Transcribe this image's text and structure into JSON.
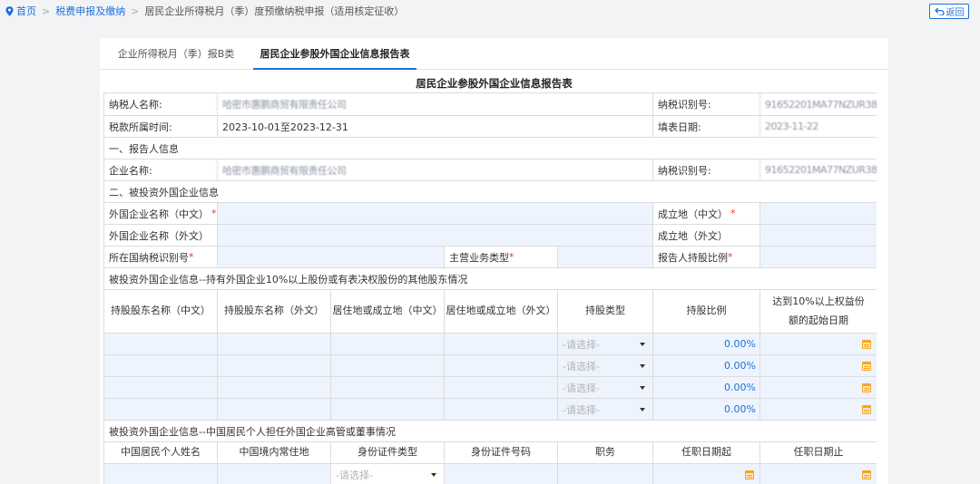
{
  "breadcrumb": {
    "home": "首页",
    "level2": "税费申报及缴纳",
    "current": "居民企业所得税月（季）度预缴纳税申报（适用核定征收）"
  },
  "back_button": "返回",
  "tabs": [
    "企业所得税月（季）报B类",
    "居民企业参股外国企业信息报告表"
  ],
  "form_title": "居民企业参股外国企业信息报告表",
  "basic": {
    "taxpayer_name_label": "纳税人名称:",
    "taxpayer_name_value": "哈密市惠鹏商贸有限责任公司",
    "tax_id_label": "纳税识别号:",
    "tax_id_value": "91652201MA77NZUR38",
    "period_label": "税款所属时间:",
    "period_value": "2023-10-01至2023-12-31",
    "fill_date_label": "填表日期:",
    "fill_date_value": "2023-11-22"
  },
  "section1": {
    "title": "一、报告人信息",
    "company_label": "企业名称:",
    "company_value": "哈密市惠鹏商贸有限责任公司",
    "tax_id_label": "纳税识别号:",
    "tax_id_value": "91652201MA77NZUR38"
  },
  "section2": {
    "title": "二、被投资外国企业信息",
    "name_cn_label": "外国企业名称（中文）",
    "place_cn_label": "成立地（中文）",
    "name_foreign_label": "外国企业名称（外文）",
    "place_foreign_label": "成立地（外文）",
    "country_taxid_label": "所在国纳税识别号",
    "business_type_label": "主营业务类型",
    "holding_ratio_label": "报告人持股比例",
    "required_mark": "*"
  },
  "shareholders": {
    "title": "被投资外国企业信息--持有外国企业10%以上股份或有表决权股份的其他股东情况",
    "headers": [
      "持股股东名称（中文）",
      "持股股东名称（外文）",
      "居住地或成立地（中文）",
      "居住地或成立地（外文）",
      "持股类型",
      "持股比例",
      "达到10%以上权益份额的起始日期"
    ],
    "select_placeholder": "-请选择-",
    "rows": [
      {
        "ratio": "0.00%"
      },
      {
        "ratio": "0.00%"
      },
      {
        "ratio": "0.00%"
      },
      {
        "ratio": "0.00%"
      }
    ]
  },
  "executives": {
    "title": "被投资外国企业信息--中国居民个人担任外国企业高管或董事情况",
    "headers": [
      "中国居民个人姓名",
      "中国境内常住地",
      "身份证件类型",
      "身份证件号码",
      "职务",
      "任职日期起",
      "任职日期止"
    ],
    "select_placeholder": "-请选择-"
  },
  "colors": {
    "accent": "#1e6fd9",
    "input_bg": "#eef4fd",
    "required": "#e33333",
    "calendar": "#f5a623"
  }
}
